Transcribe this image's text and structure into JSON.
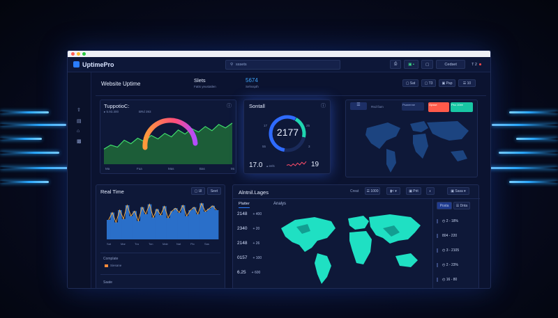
{
  "window": {
    "dots": [
      "#ff5f57",
      "#febc2e",
      "#28c840"
    ]
  },
  "appbar": {
    "logo": "UptimePro",
    "search_text": "sssets",
    "chips": [
      {
        "label": "",
        "icon": "printer-icon"
      },
      {
        "label": "▣ ▪",
        "icon": "grid-icon",
        "green": true
      },
      {
        "label": "",
        "icon": "square-icon"
      },
      {
        "label": "Cedset",
        "icon": ""
      },
      {
        "label": "T 2",
        "icon": "bell-icon"
      }
    ]
  },
  "header": {
    "title": "Website Uptime",
    "stat1_label": "Slets",
    "stat1_sub": "Fatts yeustatlen",
    "stat2_value": "5674",
    "stat2_sub": "Sehsspth",
    "buttons": [
      "▢ Sat",
      "▢ T3",
      "▣ Pap",
      "☰ 10"
    ]
  },
  "nav": {
    "icons": [
      "upload-icon",
      "file-icon",
      "home-icon",
      "image-icon"
    ]
  },
  "uptime_panel": {
    "title": "TuppotioC:",
    "legend1": "▸ 5.93.300",
    "legend2": "BRd 393",
    "info": "ⓘ",
    "xlabels": [
      "Ma",
      "Fua",
      "Mas",
      "Bas",
      "Mar"
    ],
    "area_values": [
      22,
      28,
      25,
      35,
      30,
      38,
      33,
      42,
      37,
      45,
      40,
      50,
      44,
      52,
      47,
      55,
      49,
      58,
      53,
      60
    ]
  },
  "gauge_panel": {
    "title": "Sontall",
    "value": "2177",
    "ticks": [
      "17",
      "25",
      "55",
      "3"
    ],
    "footer_value": "17.0",
    "footer_unit": "▴ eels",
    "footer_right": "19",
    "mini_line": [
      10,
      12,
      8,
      14,
      9,
      16,
      11,
      18,
      13,
      20
    ]
  },
  "map_top": {
    "tag1": "Rsd fiam",
    "tag2": "Psanenne",
    "tag3": "Opsse",
    "tag4": "Psu 10ee"
  },
  "realtime": {
    "title": "Real Time",
    "btn1": "▢ Ul",
    "btn2": "Seet",
    "xlabels": [
      "Sat",
      "Mar",
      "Tra",
      "Ton",
      "Mab",
      "Nat",
      "Plo",
      "Sas"
    ],
    "legend_title": "Complate",
    "legend_item": "Siesane",
    "footer": "Saate",
    "series": [
      40,
      55,
      35,
      60,
      42,
      70,
      48,
      58,
      38,
      66,
      52,
      72,
      45,
      62,
      50,
      68,
      44,
      58,
      64,
      55,
      70,
      48,
      60,
      66,
      52,
      74,
      57,
      63,
      69,
      60
    ]
  },
  "analytics": {
    "title": "Alntnil.Lages",
    "controls": [
      "Creat",
      "☰ 1000",
      "▮< ▾",
      "▣ Prit",
      "◐",
      "▣ Sasa ▾"
    ],
    "tab1": "Platter",
    "tab2": "Analys",
    "rows": [
      {
        "value": "2148",
        "delta": "+ 400"
      },
      {
        "value": "2340",
        "delta": "+ 20"
      },
      {
        "value": "2148",
        "delta": "+ 26"
      },
      {
        "value": "0157",
        "delta": "+ 100"
      },
      {
        "value": "6.25",
        "delta": "+ 600"
      }
    ],
    "right_tabs": [
      "Posta",
      "☰ Dnta"
    ],
    "right_rows": [
      "◴ 2 - 18%",
      "804 - 220",
      "◴ 3 - 2105",
      "◴ 2 - 23%",
      "◴ 16 - 80"
    ]
  },
  "colors": {
    "accent": "#2a7dff",
    "area_fill": "#1f7a3a",
    "area_line": "#39d353",
    "teal": "#1fe0c3",
    "red": "#ff5a4a",
    "map_dark": "#1b3f72"
  }
}
